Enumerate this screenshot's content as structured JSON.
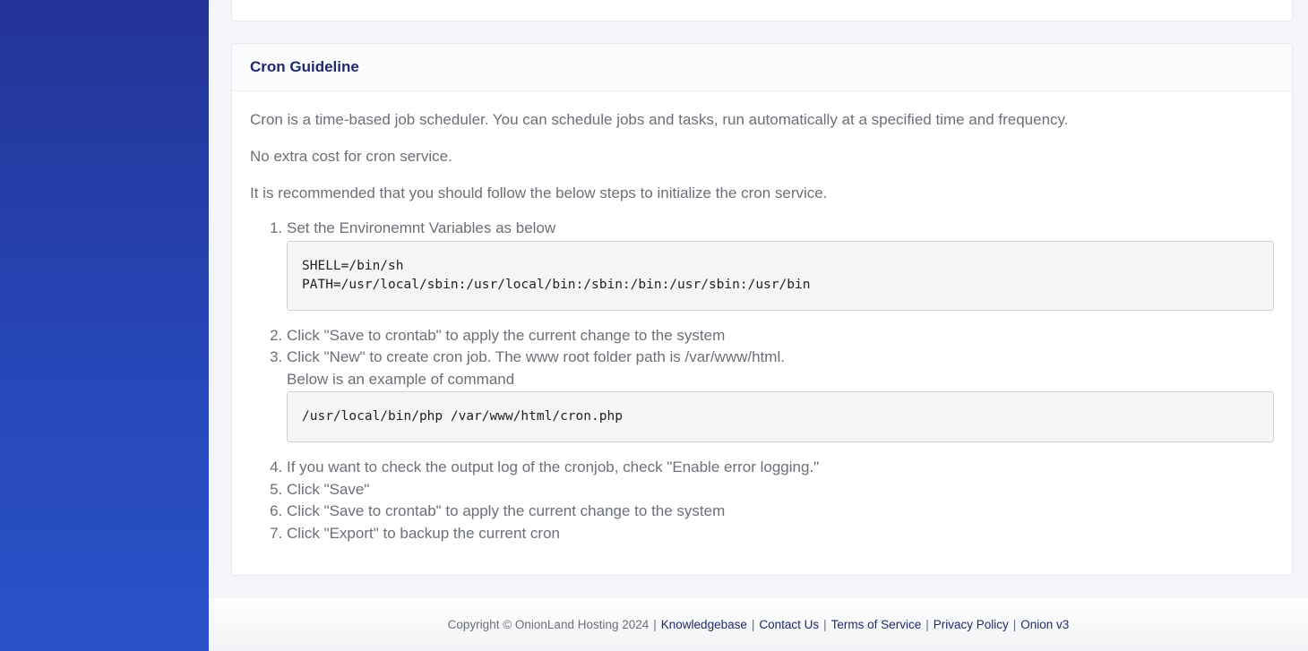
{
  "card": {
    "title": "Cron Guideline",
    "intro": "Cron is a time-based job scheduler. You can schedule jobs and tasks, run automatically at a specified time and frequency.",
    "cost": "No extra cost for cron service.",
    "recommend": "It is recommended that you should follow the below steps to initialize the cron service.",
    "steps": {
      "s1": "Set the Environemnt Variables as below",
      "code1_line1": "SHELL=/bin/sh",
      "code1_line2": "PATH=/usr/local/sbin:/usr/local/bin:/sbin:/bin:/usr/sbin:/usr/bin",
      "s2": "Click \"Save to crontab\" to apply the current change to the system",
      "s3_line1": "Click \"New\" to create cron job. The www root folder path is /var/www/html.",
      "s3_line2": "Below is an example of command",
      "code2": "/usr/local/bin/php /var/www/html/cron.php",
      "s4": "If you want to check the output log of the cronjob, check \"Enable error logging.\"",
      "s5": "Click \"Save\"",
      "s6": "Click \"Save to crontab\" to apply the current change to the system",
      "s7": "Click \"Export\" to backup the current cron"
    }
  },
  "footer": {
    "copyright": "Copyright © OnionLand Hosting 2024",
    "separator": "|",
    "links": {
      "knowledgebase": "Knowledgebase",
      "contact": "Contact Us",
      "terms": "Terms of Service",
      "privacy": "Privacy Policy",
      "onion": "Onion v3"
    }
  },
  "colors": {
    "sidebar_top": "#233495",
    "sidebar_bottom": "#2a52c8",
    "title": "#1f2a6b",
    "text": "#6b6f78"
  }
}
